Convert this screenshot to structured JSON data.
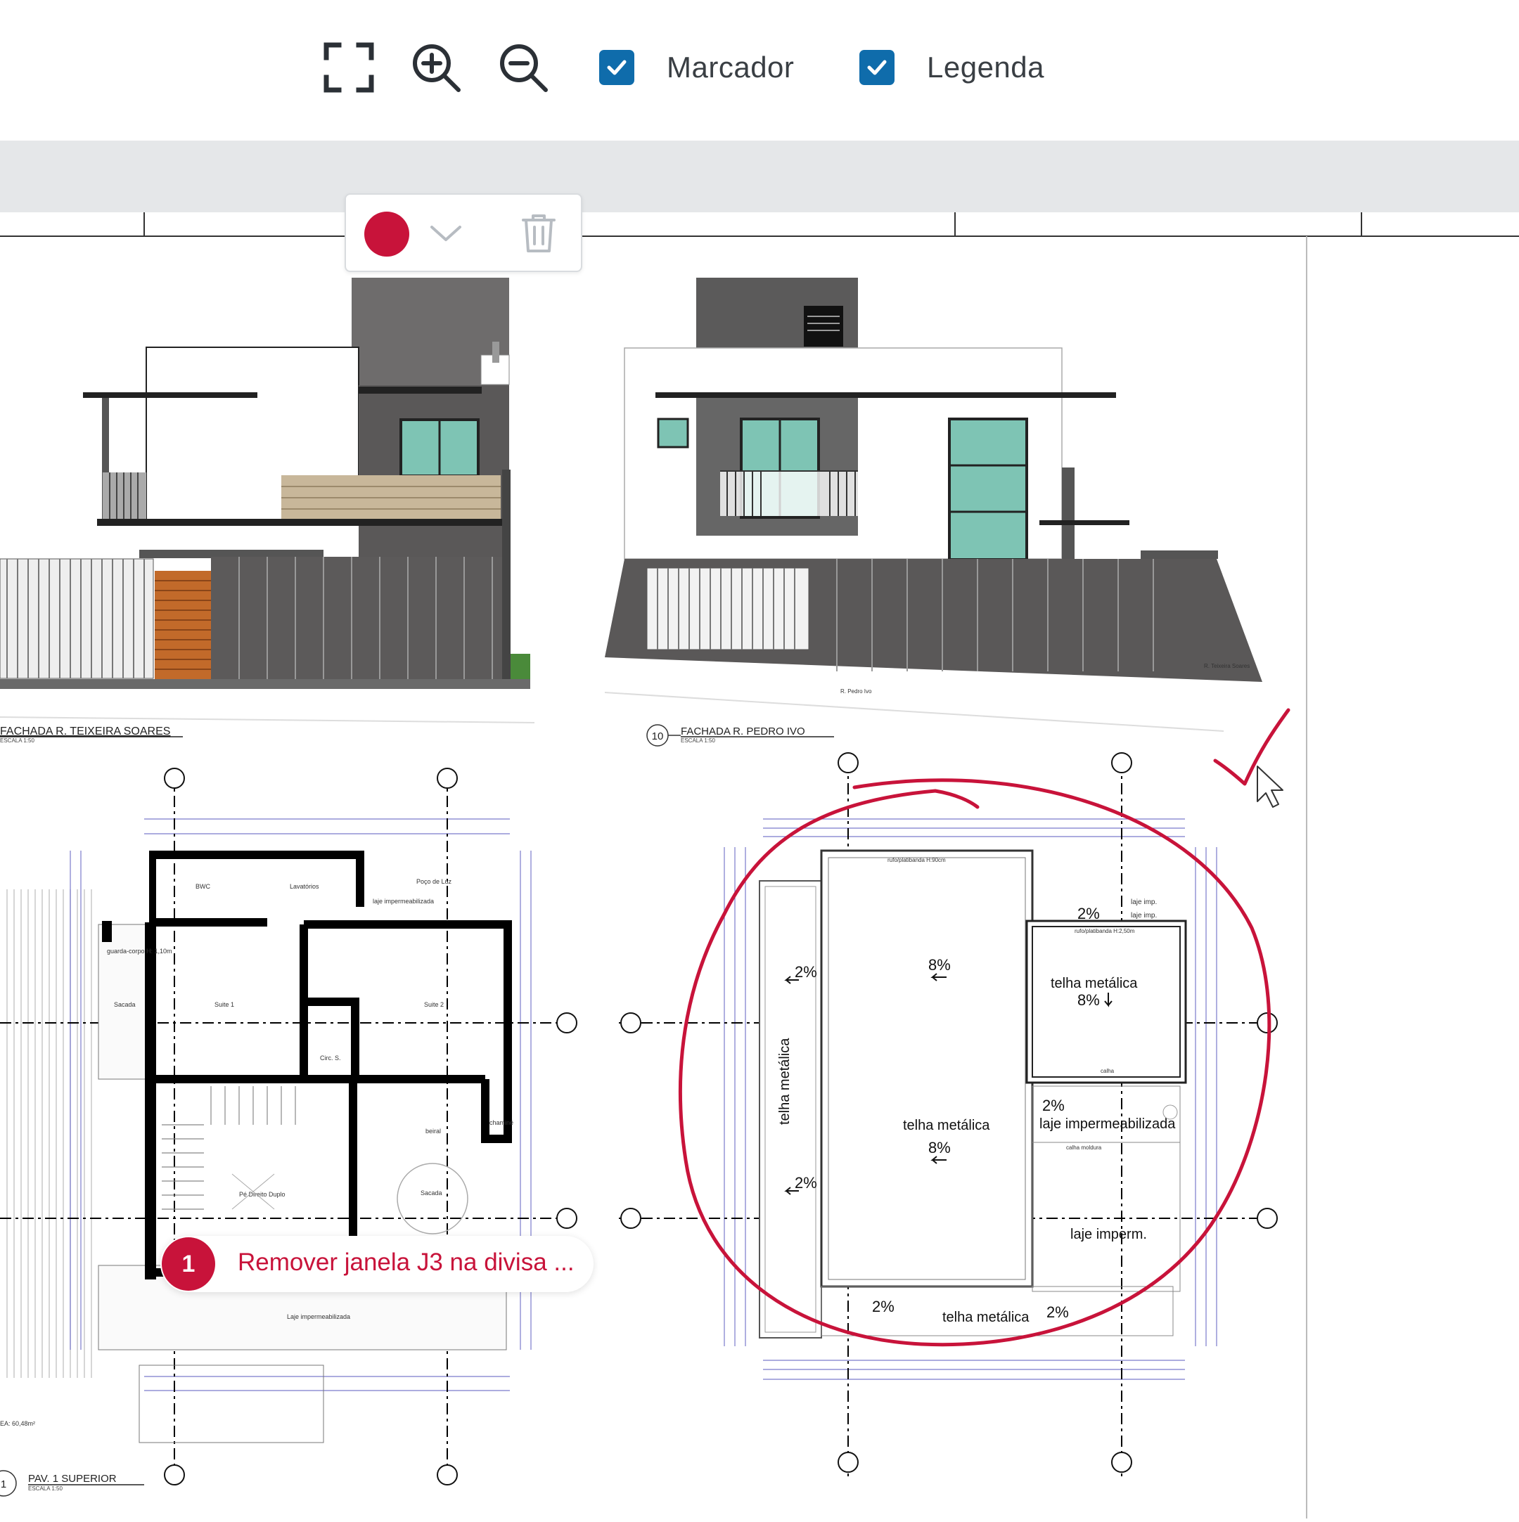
{
  "toolbar": {
    "fit_icon": "fullscreen-icon",
    "zoom_in_icon": "zoom-in-icon",
    "zoom_out_icon": "zoom-out-icon",
    "checkboxes": [
      {
        "label": "Marcador",
        "checked": true
      },
      {
        "label": "Legenda",
        "checked": true
      }
    ]
  },
  "color_popup": {
    "selected_color": "#c8133a",
    "dropdown_icon": "chevron-down-icon",
    "delete_icon": "trash-icon"
  },
  "drawing": {
    "elevation_left": {
      "title": "FACHADA R. TEIXEIRA SOARES",
      "scale": "ESCALA 1:50"
    },
    "elevation_right": {
      "number": "10",
      "title": "FACHADA R. PEDRO IVO",
      "scale": "ESCALA 1:50",
      "street_a": "R. Pedro Ivo",
      "street_b": "R. Teixeira Soares"
    },
    "floor_plan": {
      "number": "1",
      "title": "PAV. 1 SUPERIOR",
      "scale": "ESCALA 1:50",
      "area": "EA: 60,48m²",
      "rooms": [
        "BWC",
        "Lavatórios",
        "Poço de Luz",
        "laje impermeabilizada",
        "Sacada",
        "Suite 1",
        "Suite 2",
        "Circ. S.",
        "Pé Direito Duplo",
        "Sacada",
        "Laje impermeabilizada",
        "guarda-corpo H: 1,10m",
        "beiral",
        "chaminé"
      ]
    },
    "roof_plan": {
      "labels": [
        "telha metálica",
        "telha metálica",
        "telha metálica",
        "telha metálica",
        "laje impermeabilizada",
        "laje imperm.",
        "laje imp.",
        "laje imp."
      ],
      "slopes": [
        "2%",
        "2%",
        "8%",
        "8%",
        "8%",
        "2%",
        "2%",
        "2%",
        "2%"
      ],
      "notes": [
        "rufo/platibanda H:90cm",
        "rufo/platibanda H:2,50m",
        "calha",
        "calha moldura"
      ]
    }
  },
  "annotations": {
    "marker": {
      "number": "1",
      "text": "Remover janela J3 na divisa ...",
      "color": "#c8133a"
    },
    "circle_color": "#c8133a"
  }
}
